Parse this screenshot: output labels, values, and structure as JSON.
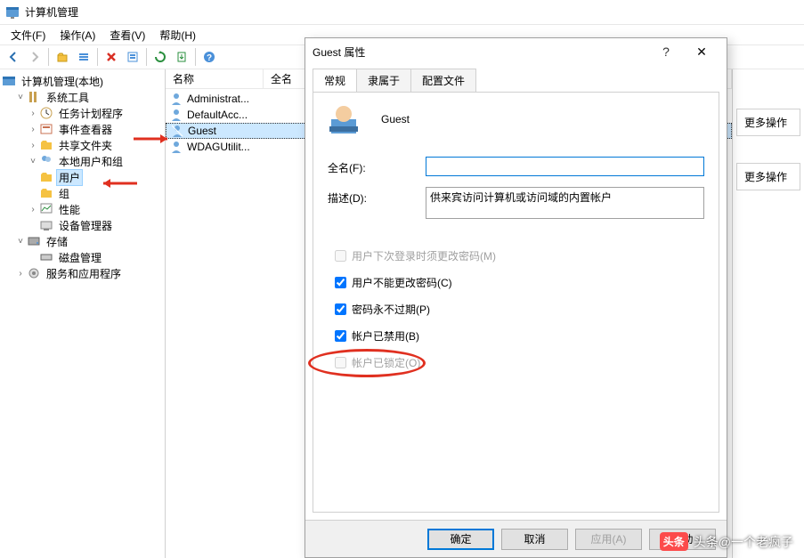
{
  "app": {
    "title": "计算机管理"
  },
  "menu": {
    "file": "文件(F)",
    "action": "操作(A)",
    "view": "查看(V)",
    "help": "帮助(H)"
  },
  "tree": {
    "root": "计算机管理(本地)",
    "systools": "系统工具",
    "task": "任务计划程序",
    "eventvwr": "事件查看器",
    "shared": "共享文件夹",
    "localusers": "本地用户和组",
    "users": "用户",
    "groups": "组",
    "perf": "性能",
    "devmgr": "设备管理器",
    "storage": "存储",
    "diskmgr": "磁盘管理",
    "services": "服务和应用程序"
  },
  "list": {
    "col_name": "名称",
    "col_full": "全名",
    "items": [
      "Administrat...",
      "DefaultAcc...",
      "Guest",
      "WDAGUtilit..."
    ]
  },
  "actions": {
    "more": "更多操作",
    "more2": "更多操作"
  },
  "dialog": {
    "title": "Guest 属性",
    "tabs": {
      "general": "常规",
      "member": "隶属于",
      "profile": "配置文件"
    },
    "username": "Guest",
    "fullname_label": "全名(F):",
    "fullname_value": "",
    "desc_label": "描述(D):",
    "desc_value": "供来宾访问计算机或访问域的内置帐户",
    "chk_mustchange": "用户下次登录时须更改密码(M)",
    "chk_cantchange": "用户不能更改密码(C)",
    "chk_neverexpire": "密码永不过期(P)",
    "chk_disabled": "帐户已禁用(B)",
    "chk_locked": "帐户已锁定(O)",
    "btn_ok": "确定",
    "btn_cancel": "取消",
    "btn_apply": "应用(A)",
    "btn_help": "帮助"
  },
  "watermark": "头条@一个老疯子"
}
